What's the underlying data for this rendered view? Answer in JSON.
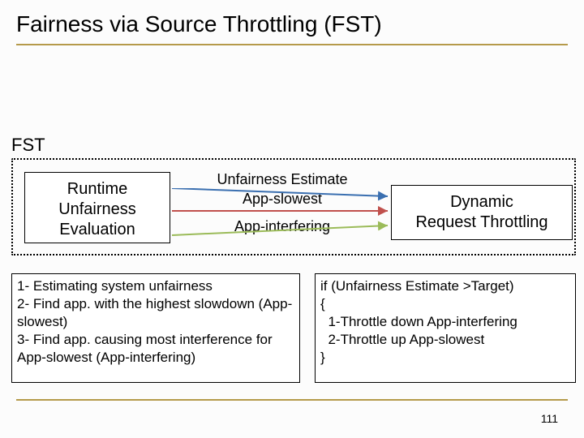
{
  "title": "Fairness via Source Throttling (FST)",
  "fst_label": "FST",
  "runtime": {
    "l1": "Runtime",
    "l2": "Unfairness",
    "l3": "Evaluation"
  },
  "dynamic": {
    "l1": "Dynamic",
    "l2": "Request Throttling"
  },
  "mid": {
    "l1": "Unfairness Estimate",
    "l2": "App-slowest",
    "l3": "App-interfering"
  },
  "left_box": "1- Estimating system unfairness\n2- Find app. with the highest slowdown (App-slowest)\n3- Find app. causing most interference for App-slowest (App-interfering)",
  "right_box": "if (Unfairness Estimate >Target)\n{\n  1-Throttle down App-interfering\n  2-Throttle up App-slowest\n}",
  "page": "111",
  "colors": {
    "arrow1": "#3a6fb0",
    "arrow2": "#c0504d",
    "arrow3": "#9bbb59"
  }
}
